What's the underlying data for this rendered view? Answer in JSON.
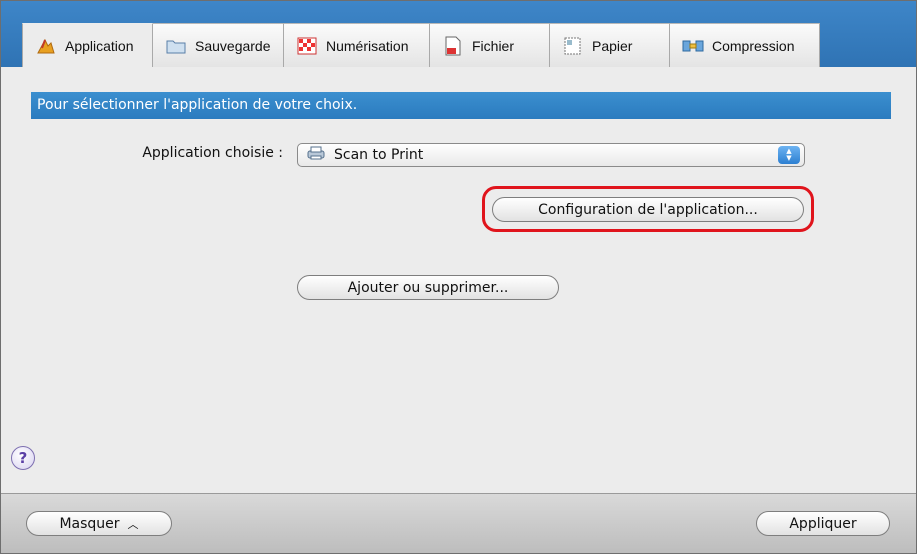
{
  "tabs": [
    {
      "label": "Application",
      "icon": "application-icon",
      "active": true
    },
    {
      "label": "Sauvegarde",
      "icon": "folder-icon",
      "active": false
    },
    {
      "label": "Numérisation",
      "icon": "scan-icon",
      "active": false
    },
    {
      "label": "Fichier",
      "icon": "file-icon",
      "active": false
    },
    {
      "label": "Papier",
      "icon": "paper-icon",
      "active": false
    },
    {
      "label": "Compression",
      "icon": "compression-icon",
      "active": false
    }
  ],
  "section": {
    "title": "Pour sélectionner l'application de votre choix."
  },
  "app_select": {
    "label": "Application choisie :",
    "value": "Scan to Print",
    "icon": "printer-icon"
  },
  "buttons": {
    "config": "Configuration de l'application...",
    "add_remove": "Ajouter ou supprimer...",
    "hide": "Masquer",
    "apply": "Appliquer"
  },
  "help": {
    "glyph": "?"
  },
  "colors": {
    "header_blue": "#2f73b4",
    "section_blue": "#2b7bbf",
    "highlight_red": "#e0141c"
  }
}
